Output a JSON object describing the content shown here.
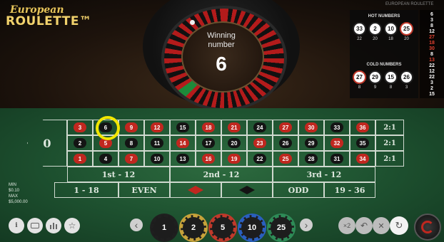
{
  "header": {
    "logo_top": "European",
    "logo_bottom": "ROULETTE™",
    "site_title": "EUROPEAN ROULETTE"
  },
  "wheel": {
    "winning_label_line1": "Winning",
    "winning_label_line2": "number",
    "winning_number": "6"
  },
  "hot_numbers": {
    "title": "HOT NUMBERS",
    "numbers": [
      "33",
      "2",
      "10",
      "25"
    ],
    "counts": [
      "22",
      "20",
      "18",
      "20"
    ],
    "number_colors": [
      "black",
      "black",
      "black",
      "red"
    ]
  },
  "cold_numbers": {
    "title": "COLD NUMBERS",
    "numbers": [
      "27",
      "29",
      "15",
      "26"
    ],
    "counts": [
      "8",
      "9",
      "8",
      "3"
    ],
    "number_colors": [
      "red",
      "black",
      "black",
      "black"
    ]
  },
  "history": [
    {
      "n": "6",
      "c": "#ffffff"
    },
    {
      "n": "3",
      "c": "#ffffff"
    },
    {
      "n": "8",
      "c": "#ffffff"
    },
    {
      "n": "12",
      "c": "#ffffff"
    },
    {
      "n": "27",
      "c": "#e04030"
    },
    {
      "n": "18",
      "c": "#e04030"
    },
    {
      "n": "30",
      "c": "#e04030"
    },
    {
      "n": "8",
      "c": "#ffffff"
    },
    {
      "n": "13",
      "c": "#e04030"
    },
    {
      "n": "22",
      "c": "#ffffff"
    },
    {
      "n": "12",
      "c": "#ffffff"
    },
    {
      "n": "22",
      "c": "#ffffff"
    },
    {
      "n": "3",
      "c": "#ffffff"
    },
    {
      "n": "2",
      "c": "#ffffff"
    },
    {
      "n": "15",
      "c": "#ffffff"
    }
  ],
  "table": {
    "zero": "0",
    "row1": [
      {
        "n": "3",
        "c": "r"
      },
      {
        "n": "6",
        "c": "b"
      },
      {
        "n": "9",
        "c": "r"
      },
      {
        "n": "12",
        "c": "r"
      },
      {
        "n": "15",
        "c": "b"
      },
      {
        "n": "18",
        "c": "r"
      },
      {
        "n": "21",
        "c": "r"
      },
      {
        "n": "24",
        "c": "b"
      },
      {
        "n": "27",
        "c": "r"
      },
      {
        "n": "30",
        "c": "r"
      },
      {
        "n": "33",
        "c": "b"
      },
      {
        "n": "36",
        "c": "r"
      }
    ],
    "row2": [
      {
        "n": "2",
        "c": "b"
      },
      {
        "n": "5",
        "c": "r"
      },
      {
        "n": "8",
        "c": "b"
      },
      {
        "n": "11",
        "c": "b"
      },
      {
        "n": "14",
        "c": "r"
      },
      {
        "n": "17",
        "c": "b"
      },
      {
        "n": "20",
        "c": "b"
      },
      {
        "n": "23",
        "c": "r"
      },
      {
        "n": "26",
        "c": "b"
      },
      {
        "n": "29",
        "c": "b"
      },
      {
        "n": "32",
        "c": "r"
      },
      {
        "n": "35",
        "c": "b"
      }
    ],
    "row3": [
      {
        "n": "1",
        "c": "r"
      },
      {
        "n": "4",
        "c": "b"
      },
      {
        "n": "7",
        "c": "r"
      },
      {
        "n": "10",
        "c": "b"
      },
      {
        "n": "13",
        "c": "b"
      },
      {
        "n": "16",
        "c": "r"
      },
      {
        "n": "19",
        "c": "r"
      },
      {
        "n": "22",
        "c": "b"
      },
      {
        "n": "25",
        "c": "r"
      },
      {
        "n": "28",
        "c": "b"
      },
      {
        "n": "31",
        "c": "b"
      },
      {
        "n": "34",
        "c": "r"
      }
    ],
    "columns": [
      "2:1",
      "2:1",
      "2:1"
    ],
    "dozens": [
      "1st - 12",
      "2nd - 12",
      "3rd - 12"
    ],
    "outside": [
      "1 - 18",
      "EVEN",
      "ODD",
      "19 - 36"
    ],
    "red": "#c0271f",
    "black": "#141414"
  },
  "limits": {
    "min_label": "MIN",
    "min_value": "$0.10",
    "max_label": "MAX",
    "max_value": "$5,000.00"
  },
  "chips": [
    {
      "v": "1",
      "ring": "#1f1f1f"
    },
    {
      "v": "2",
      "ring": "#c7a23a"
    },
    {
      "v": "5",
      "ring": "#c0392b"
    },
    {
      "v": "10",
      "ring": "#2a5fbf"
    },
    {
      "v": "25",
      "ring": "#2e8b57"
    }
  ],
  "controls": {
    "info": "i",
    "double": "×2",
    "undo": "↶",
    "clear": "✕",
    "rebet": "↻",
    "prev": "‹",
    "next": "›"
  }
}
